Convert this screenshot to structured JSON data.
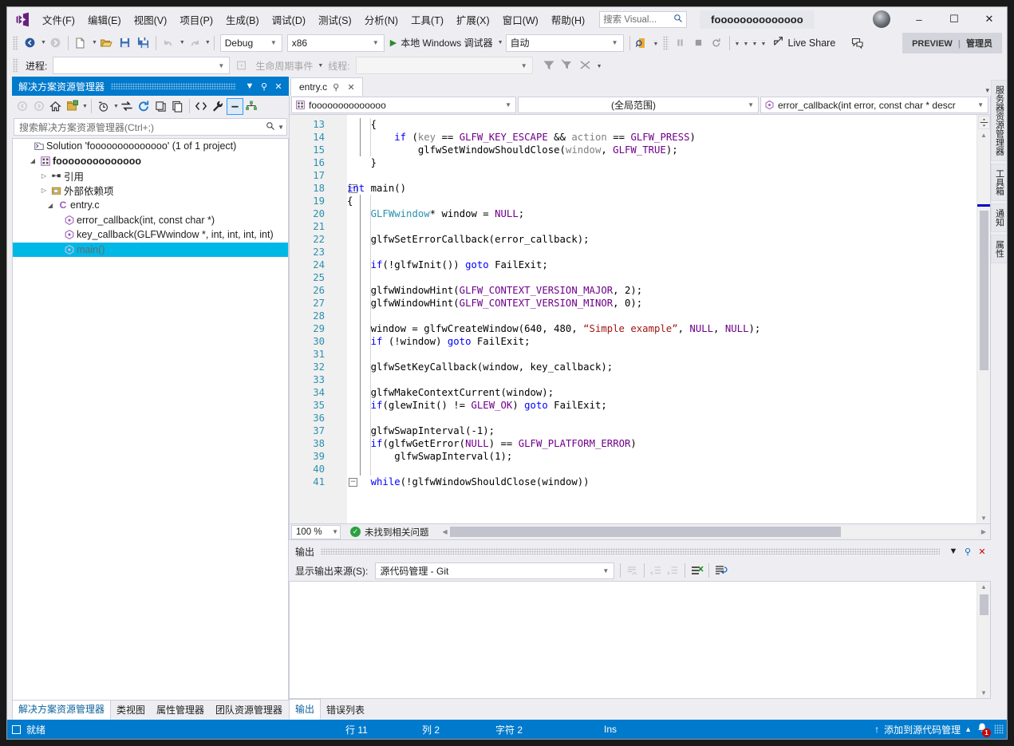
{
  "window": {
    "title": "foooooooooooooo",
    "search_placeholder": "搜索 Visual...",
    "minimize": "–",
    "maximize": "☐",
    "close": "✕"
  },
  "menu": {
    "items": [
      "文件(F)",
      "编辑(E)",
      "视图(V)",
      "项目(P)",
      "生成(B)",
      "调试(D)",
      "测试(S)",
      "分析(N)",
      "工具(T)",
      "扩展(X)",
      "窗口(W)",
      "帮助(H)"
    ]
  },
  "toolbar": {
    "config": "Debug",
    "platform": "x86",
    "run_label": "本地 Windows 调试器",
    "auto": "自动",
    "live_share": "Live Share",
    "preview_badge": "PREVIEW",
    "admin_badge": "管理员",
    "process_label": "进程:",
    "process_value": "",
    "lifecycle_label": "生命周期事件",
    "thread_label": "线程:",
    "thread_value": ""
  },
  "solution_explorer": {
    "title": "解决方案资源管理器",
    "search_placeholder": "搜索解决方案资源管理器(Ctrl+;)",
    "tree": [
      {
        "label": "Solution 'foooooooooooooo' (1 of 1 project)",
        "indent": 0,
        "arrow": "",
        "icon": "solution-icon",
        "bold": false,
        "selected": false
      },
      {
        "label": "foooooooooooooo",
        "indent": 1,
        "arrow": "◢",
        "icon": "project-icon",
        "bold": true,
        "selected": false
      },
      {
        "label": "引用",
        "indent": 2,
        "arrow": "▷",
        "icon": "references-icon",
        "bold": false,
        "selected": false
      },
      {
        "label": "外部依赖项",
        "indent": 2,
        "arrow": "▷",
        "icon": "folder-icon",
        "bold": false,
        "selected": false
      },
      {
        "label": "entry.c",
        "indent": 2,
        "arrow": "◢",
        "icon": "c-file-icon",
        "bold": false,
        "selected": false
      },
      {
        "label": "error_callback(int, const char *)",
        "indent": 3,
        "arrow": "",
        "icon": "function-icon",
        "bold": false,
        "selected": false
      },
      {
        "label": "key_callback(GLFWwindow *, int, int, int, int)",
        "indent": 3,
        "arrow": "",
        "icon": "function-icon",
        "bold": false,
        "selected": false
      },
      {
        "label": "main()",
        "indent": 3,
        "arrow": "",
        "icon": "function-icon",
        "bold": false,
        "selected": true
      }
    ],
    "bottom_tabs": [
      "解决方案资源管理器",
      "类视图",
      "属性管理器",
      "团队资源管理器"
    ]
  },
  "editor": {
    "tab_name": "entry.c",
    "nav_project": "foooooooooooooo",
    "nav_scope": "(全局范围)",
    "nav_member": "error_callback(int error, const char * descr",
    "zoom": "100 %",
    "issue_status": "未找到相关问题",
    "lines": [
      {
        "n": 13,
        "fold": "",
        "html": "    {"
      },
      {
        "n": 14,
        "fold": "",
        "html": "        <span class='kw'>if</span> (<span class='var'>key</span> == <span class='mac'>GLFW_KEY_ESCAPE</span> &amp;&amp; <span class='var'>action</span> == <span class='mac'>GLFW_PRESS</span>)"
      },
      {
        "n": 15,
        "fold": "",
        "html": "            glfwSetWindowShouldClose(<span class='var'>window</span>, <span class='mac'>GLFW_TRUE</span>);"
      },
      {
        "n": 16,
        "fold": "",
        "html": "    }"
      },
      {
        "n": 17,
        "fold": "",
        "html": ""
      },
      {
        "n": 18,
        "fold": "-",
        "html": "<span class='kw'>int</span> main()"
      },
      {
        "n": 19,
        "fold": "",
        "html": "{"
      },
      {
        "n": 20,
        "fold": "",
        "html": "    <span class='typ'>GLFWwindow</span>* window = <span class='mac'>NULL</span>;"
      },
      {
        "n": 21,
        "fold": "",
        "html": ""
      },
      {
        "n": 22,
        "fold": "",
        "html": "    glfwSetErrorCallback(error_callback);"
      },
      {
        "n": 23,
        "fold": "",
        "html": ""
      },
      {
        "n": 24,
        "fold": "",
        "html": "    <span class='kw'>if</span>(!glfwInit()) <span class='kw'>goto</span> FailExit;"
      },
      {
        "n": 25,
        "fold": "",
        "html": ""
      },
      {
        "n": 26,
        "fold": "",
        "html": "    glfwWindowHint(<span class='mac'>GLFW_CONTEXT_VERSION_MAJOR</span>, 2);"
      },
      {
        "n": 27,
        "fold": "",
        "html": "    glfwWindowHint(<span class='mac'>GLFW_CONTEXT_VERSION_MINOR</span>, 0);"
      },
      {
        "n": 28,
        "fold": "",
        "html": ""
      },
      {
        "n": 29,
        "fold": "",
        "html": "    window = glfwCreateWindow(640, 480, <span class='str'>“Simple example”</span>, <span class='mac'>NULL</span>, <span class='mac'>NULL</span>);"
      },
      {
        "n": 30,
        "fold": "",
        "html": "    <span class='kw'>if</span> (!window) <span class='kw'>goto</span> FailExit;"
      },
      {
        "n": 31,
        "fold": "",
        "html": ""
      },
      {
        "n": 32,
        "fold": "",
        "html": "    glfwSetKeyCallback(window, key_callback);"
      },
      {
        "n": 33,
        "fold": "",
        "html": ""
      },
      {
        "n": 34,
        "fold": "",
        "html": "    glfwMakeContextCurrent(window);"
      },
      {
        "n": 35,
        "fold": "",
        "html": "    <span class='kw'>if</span>(glewInit() != <span class='mac'>GLEW_OK</span>) <span class='kw'>goto</span> FailExit;"
      },
      {
        "n": 36,
        "fold": "",
        "html": ""
      },
      {
        "n": 37,
        "fold": "",
        "html": "    glfwSwapInterval(-1);"
      },
      {
        "n": 38,
        "fold": "",
        "html": "    <span class='kw'>if</span>(glfwGetError(<span class='mac'>NULL</span>) == <span class='mac'>GLFW_PLATFORM_ERROR</span>)"
      },
      {
        "n": 39,
        "fold": "",
        "html": "        glfwSwapInterval(1);"
      },
      {
        "n": 40,
        "fold": "",
        "html": ""
      },
      {
        "n": 41,
        "fold": "-",
        "html": "    <span class='kw'>while</span>(!glfwWindowShouldClose(window))"
      }
    ]
  },
  "output": {
    "title": "输出",
    "source_label": "显示输出来源(S):",
    "source_value": "源代码管理 - Git",
    "content": "",
    "bottom_tabs": [
      "输出",
      "错误列表"
    ]
  },
  "rail": {
    "tabs": [
      "服务器资源管理器",
      "工具箱",
      "通知",
      "属性"
    ]
  },
  "statusbar": {
    "ready": "就绪",
    "line": "行 11",
    "col": "列 2",
    "char": "字符 2",
    "ins": "Ins",
    "source_control": "添加到源代码管理",
    "notification_count": "1"
  }
}
